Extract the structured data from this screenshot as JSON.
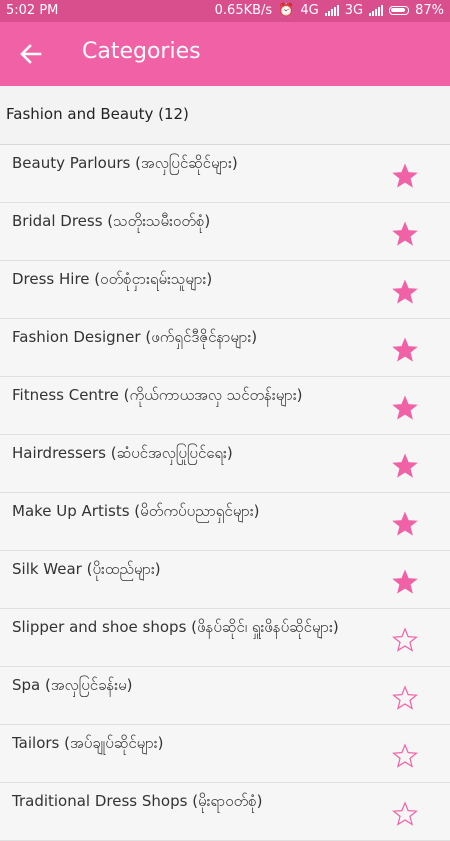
{
  "status_bar": {
    "time": "5:02 PM",
    "network_speed": "0.65KB/s",
    "network_1": "4G",
    "network_2": "3G",
    "battery": "87%"
  },
  "app_bar": {
    "title": "Categories",
    "back_icon": "arrow-left-icon"
  },
  "section": {
    "title": "Fashion and Beauty (12)"
  },
  "colors": {
    "accent": "#f061a6",
    "status_bar": "#d94f8e"
  },
  "items": [
    {
      "label": "Beauty Parlours (အလှပြင်ဆိုင်များ)",
      "favorite": true
    },
    {
      "label": "Bridal Dress (သတိုးသမီးဝတ်စုံ)",
      "favorite": true
    },
    {
      "label": "Dress Hire (ဝတ်စုံငှားရမ်းသူများ)",
      "favorite": true
    },
    {
      "label": "Fashion Designer (ဖက်ရှင်ဒီဇိုင်နာများ)",
      "favorite": true
    },
    {
      "label": "Fitness Centre (ကိုယ်ကာယအလှ သင်တန်းများ)",
      "favorite": true
    },
    {
      "label": "Hairdressers (ဆံပင်အလှပြုပြင်ရေး)",
      "favorite": true
    },
    {
      "label": "Make Up Artists (မိတ်ကပ်ပညာရှင်များ)",
      "favorite": true
    },
    {
      "label": "Silk Wear (ပိုးထည်များ)",
      "favorite": true
    },
    {
      "label": "Slipper and shoe shops (ဖိနပ်ဆိုင်၊ ရှူးဖိနပ်ဆိုင်များ)",
      "favorite": false
    },
    {
      "label": "Spa (အလှပြင်ခန်းမ)",
      "favorite": false
    },
    {
      "label": "Tailors (အပ်ချုပ်ဆိုင်များ)",
      "favorite": false
    },
    {
      "label": "Traditional Dress Shops (မိုးရာဝတ်စုံ)",
      "favorite": false
    }
  ]
}
